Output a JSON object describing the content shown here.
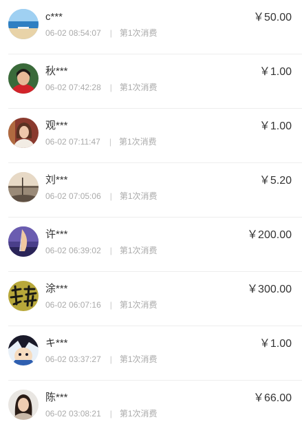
{
  "records": [
    {
      "name": "c***",
      "time": "06-02 08:54:07",
      "desc": "第1次消费",
      "amount": "￥50.00",
      "avatar": "beach-photo-icon"
    },
    {
      "name": "秋***",
      "time": "06-02 07:42:28",
      "desc": "第1次消费",
      "amount": "￥1.00",
      "avatar": "woman-red-portrait-icon"
    },
    {
      "name": "观***",
      "time": "06-02 07:11:47",
      "desc": "第1次消费",
      "amount": "￥1.00",
      "avatar": "woman-portrait-icon"
    },
    {
      "name": "刘***",
      "time": "06-02 07:05:06",
      "desc": "第1次消费",
      "amount": "￥5.20",
      "avatar": "sunset-lake-icon"
    },
    {
      "name": "许***",
      "time": "06-02 06:39:02",
      "desc": "第1次消费",
      "amount": "￥200.00",
      "avatar": "sail-hotel-icon"
    },
    {
      "name": "涂***",
      "time": "06-02 06:07:16",
      "desc": "第1次消费",
      "amount": "￥300.00",
      "avatar": "calligraphy-icon"
    },
    {
      "name": "キ***",
      "time": "06-02 03:37:27",
      "desc": "第1次消费",
      "amount": "￥1.00",
      "avatar": "anime-character-icon"
    },
    {
      "name": "陈***",
      "time": "06-02 03:08:21",
      "desc": "第1次消费",
      "amount": "￥66.00",
      "avatar": "woman-portrait-icon"
    }
  ]
}
